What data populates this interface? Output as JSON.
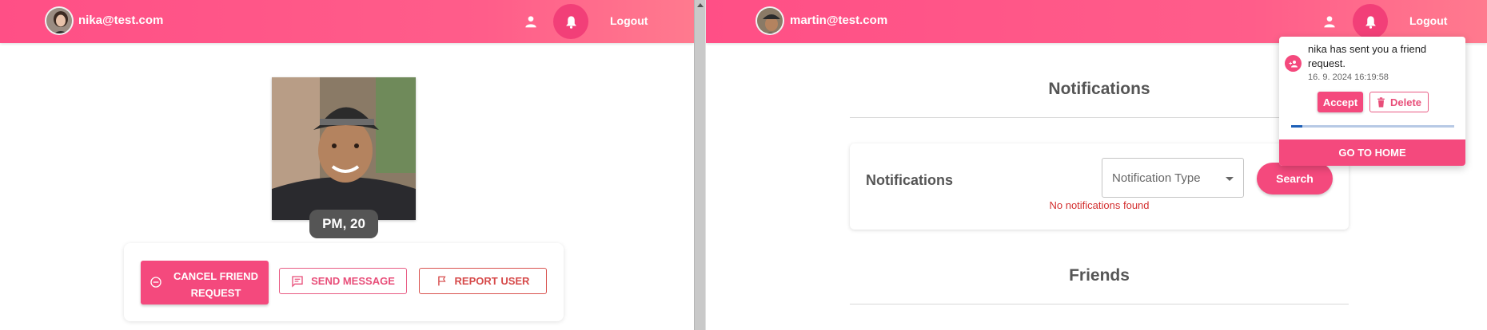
{
  "left_window": {
    "header": {
      "email": "nika@test.com",
      "logout_label": "Logout"
    },
    "profile": {
      "badge": "PM, 20"
    },
    "actions": {
      "cancel_request_label": "CANCEL FRIEND REQUEST",
      "send_message_label": "SEND MESSAGE",
      "report_user_label": "REPORT USER"
    }
  },
  "right_window": {
    "header": {
      "email": "martin@test.com",
      "logout_label": "Logout"
    },
    "notifications_page": {
      "title": "Notifications",
      "card_title": "Notifications",
      "type_select_placeholder": "Notification Type",
      "search_label": "Search",
      "empty_message": "No notifications found",
      "friends_title": "Friends"
    },
    "notification_dropdown": {
      "message": "nika has sent you a friend request.",
      "timestamp": "16. 9. 2024 16:19:58",
      "accept_label": "Accept",
      "delete_label": "Delete",
      "progress_fraction": 0.07,
      "go_home_label": "GO TO HOME"
    }
  },
  "colors": {
    "brand_pink": "#f4497d",
    "error_red": "#d32f2f",
    "progress_blue": "#1d5fb7"
  },
  "icons": [
    "person-icon",
    "bell-icon",
    "minus-circle-icon",
    "message-icon",
    "flag-icon",
    "person-add-icon",
    "trash-icon"
  ]
}
